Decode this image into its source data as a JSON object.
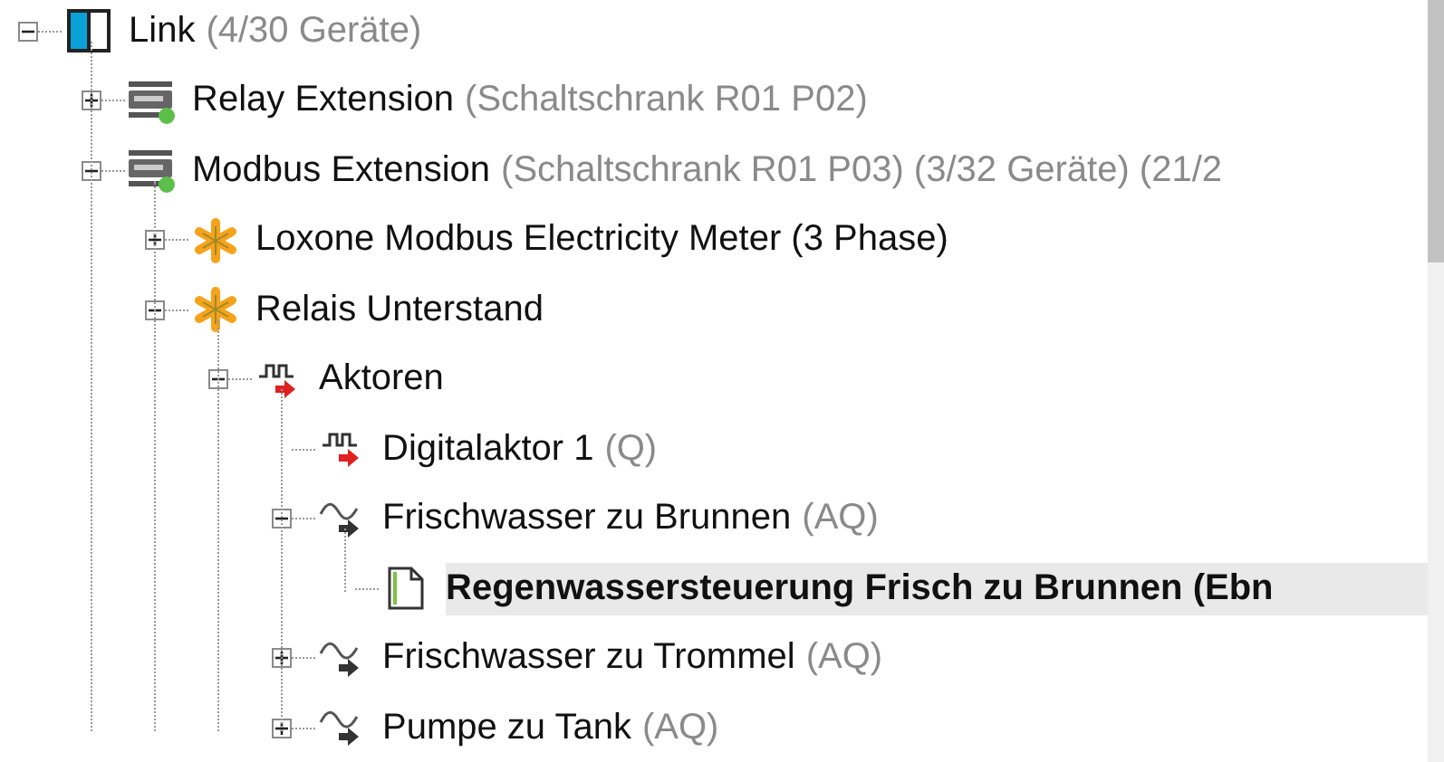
{
  "tree": [
    {
      "label": "Link",
      "detail": "(4/30 Geräte)",
      "kind": "link",
      "expanded": true,
      "selected": false,
      "children": [
        {
          "label": "Relay Extension",
          "detail": "(Schaltschrank R01 P02)",
          "kind": "extension",
          "online": true,
          "expanded": false,
          "selected": false
        },
        {
          "label": "Modbus Extension",
          "detail": "(Schaltschrank R01 P03) (3/32 Geräte) (21/2",
          "kind": "extension",
          "online": true,
          "expanded": true,
          "selected": false,
          "children": [
            {
              "label": "Loxone Modbus Electricity Meter (3 Phase)",
              "kind": "device",
              "expanded": false,
              "selected": false
            },
            {
              "label": "Relais Unterstand",
              "kind": "device",
              "expanded": true,
              "selected": false,
              "children": [
                {
                  "label": "Aktoren",
                  "kind": "digital-output",
                  "expanded": true,
                  "selected": false,
                  "children": [
                    {
                      "label": "Digitalaktor 1",
                      "detail": "(Q)",
                      "kind": "digital-output",
                      "selected": false
                    },
                    {
                      "label": "Frischwasser zu Brunnen",
                      "detail": "(AQ)",
                      "kind": "analog-output",
                      "expanded": true,
                      "selected": false,
                      "children": [
                        {
                          "label": "Regenwassersteuerung Frisch zu Brunnen (Ebn",
                          "kind": "document",
                          "selected": true
                        }
                      ]
                    },
                    {
                      "label": "Frischwasser zu Trommel",
                      "detail": "(AQ)",
                      "kind": "analog-output",
                      "expanded": false,
                      "selected": false
                    },
                    {
                      "label": "Pumpe zu Tank",
                      "detail": "(AQ)",
                      "kind": "analog-output",
                      "expanded": false,
                      "selected": false
                    }
                  ]
                }
              ]
            }
          ]
        }
      ]
    }
  ]
}
